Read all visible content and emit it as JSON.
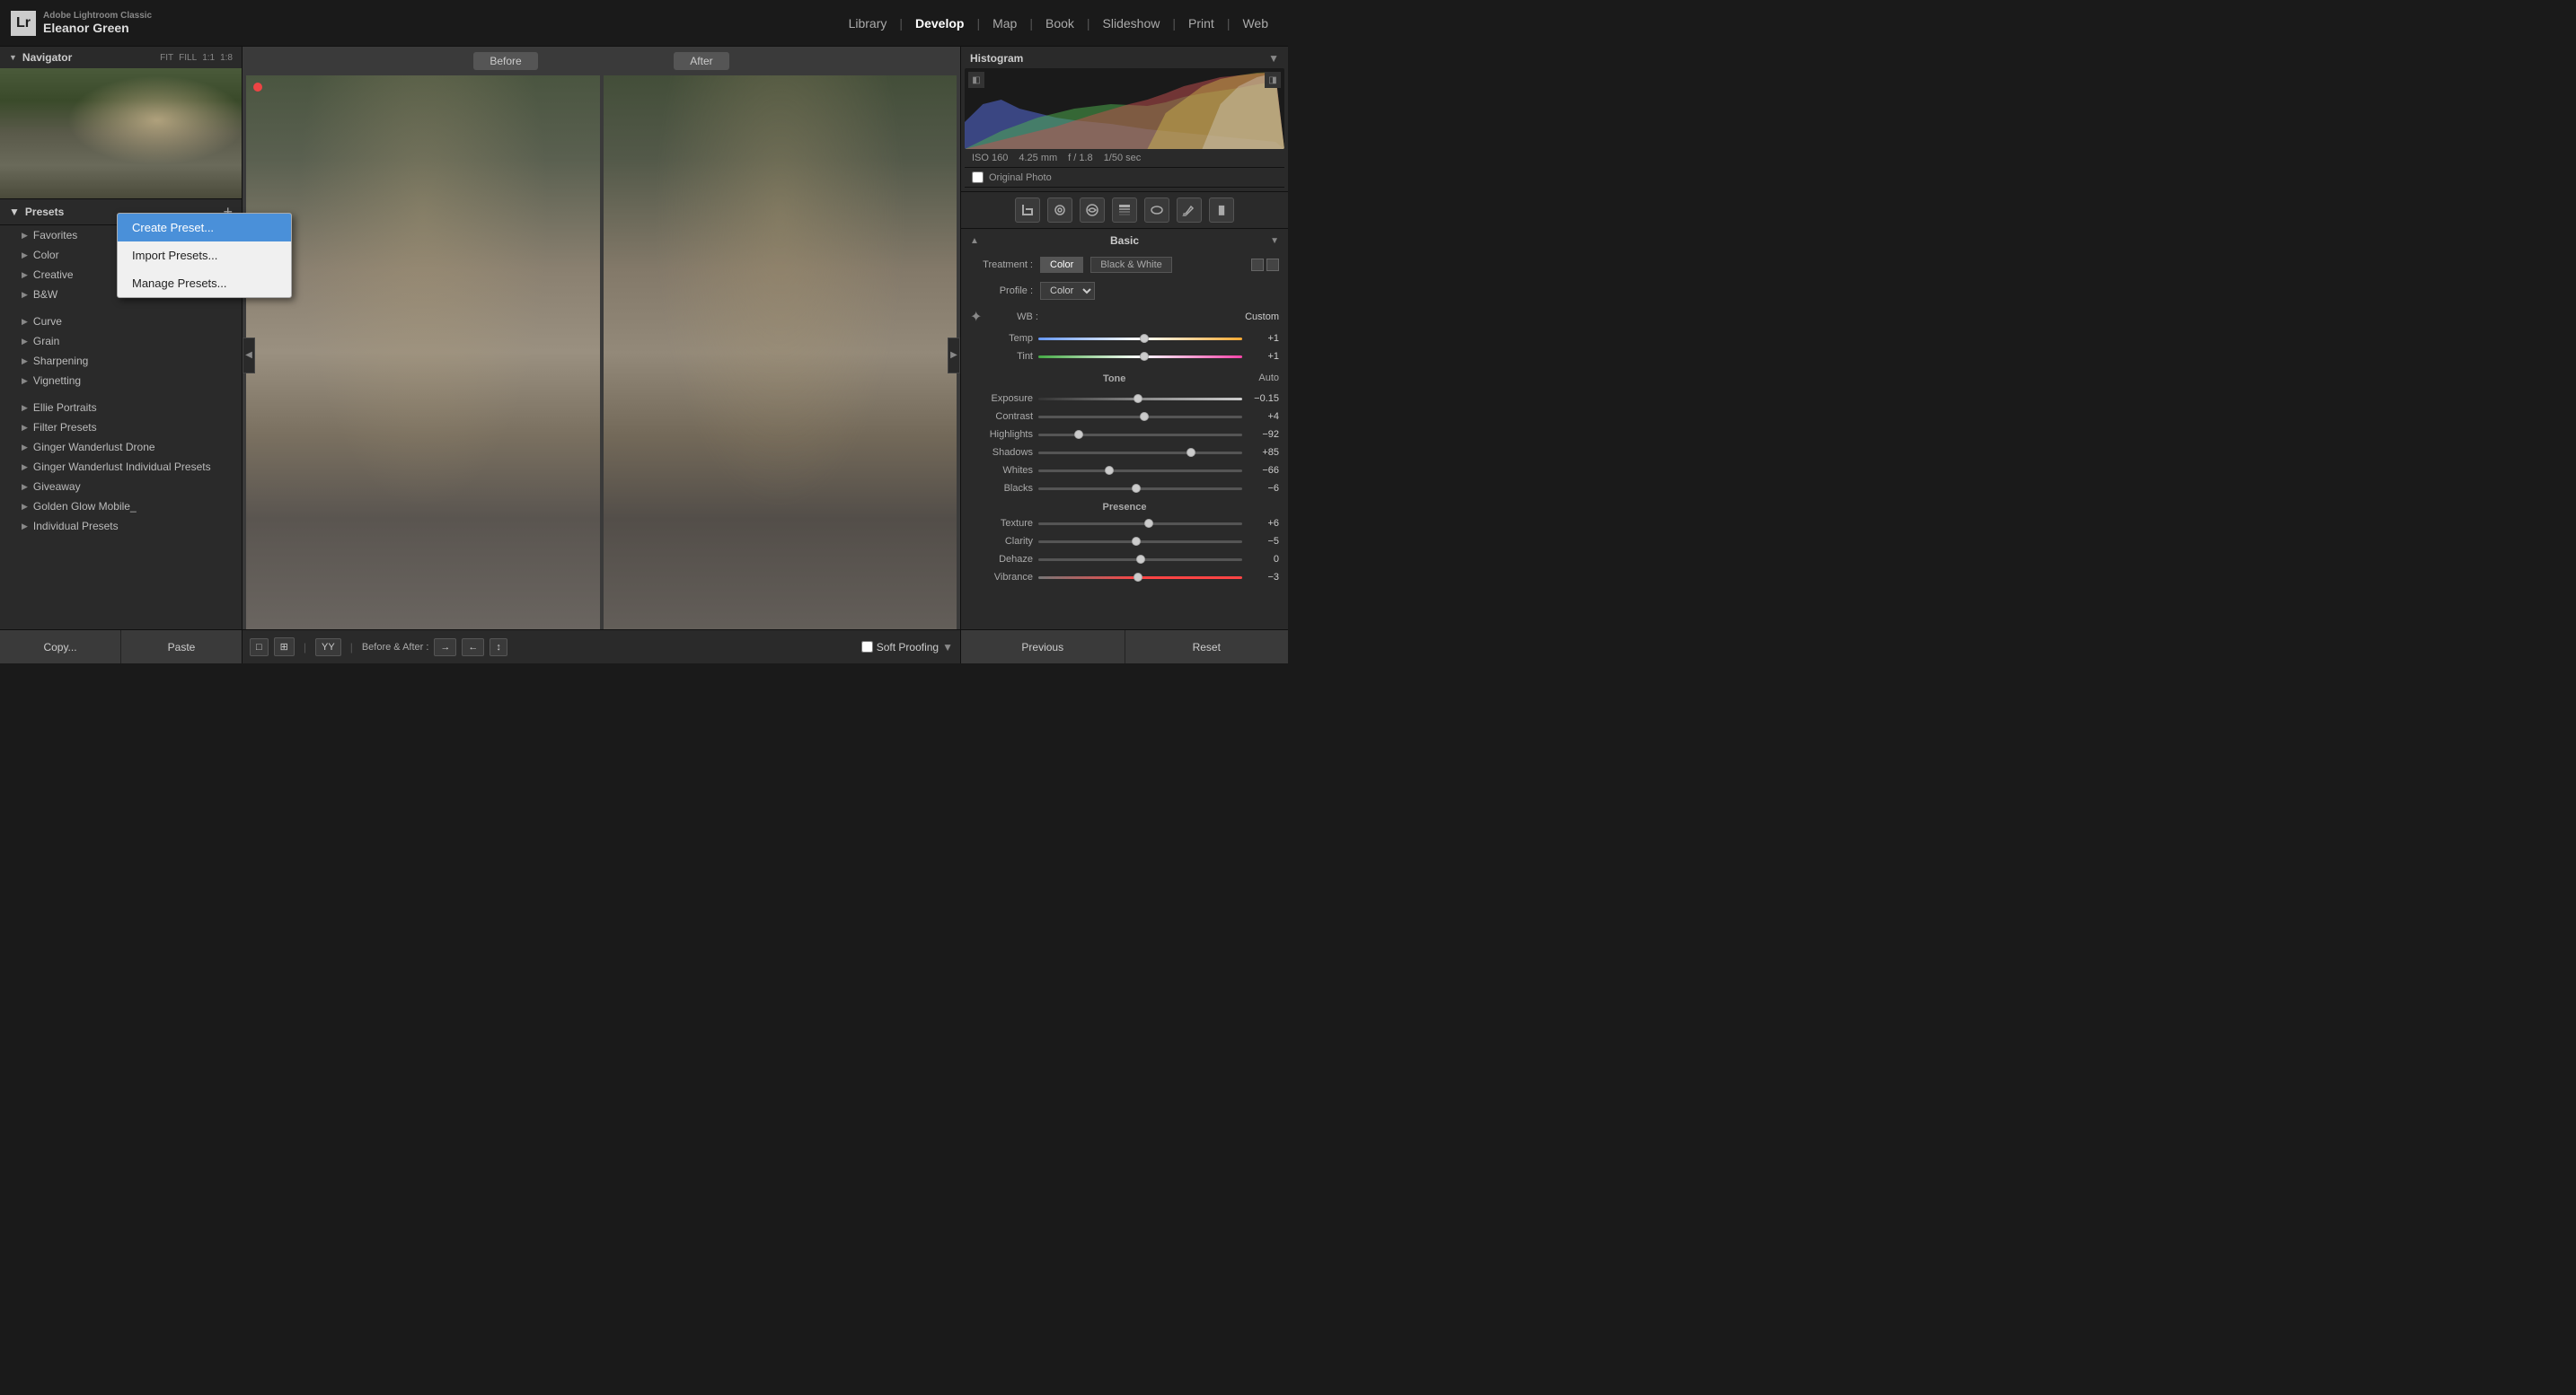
{
  "app": {
    "logo": "Lr",
    "app_name": "Adobe Lightroom Classic",
    "user_name": "Eleanor Green"
  },
  "nav": {
    "items": [
      "Library",
      "Develop",
      "Map",
      "Book",
      "Slideshow",
      "Print",
      "Web"
    ],
    "active": "Develop",
    "separators": [
      true,
      false,
      true,
      true,
      false,
      true,
      true
    ]
  },
  "navigator": {
    "title": "Navigator",
    "zoom_options": [
      "FIT",
      "FILL",
      "1:1",
      "1:8"
    ]
  },
  "presets": {
    "title": "Presets",
    "add_btn": "+",
    "items": [
      {
        "label": "Favorites",
        "level": 1
      },
      {
        "label": "Color",
        "level": 1
      },
      {
        "label": "Creative",
        "level": 1
      },
      {
        "label": "B&W",
        "level": 1
      },
      {
        "label": "Curve",
        "level": 1
      },
      {
        "label": "Grain",
        "level": 1
      },
      {
        "label": "Sharpening",
        "level": 1
      },
      {
        "label": "Vignetting",
        "level": 1
      },
      {
        "label": "Ellie Portraits",
        "level": 1
      },
      {
        "label": "Filter Presets",
        "level": 1
      },
      {
        "label": "Ginger Wanderlust Drone",
        "level": 1
      },
      {
        "label": "Ginger Wanderlust Individual Presets",
        "level": 1
      },
      {
        "label": "Giveaway",
        "level": 1
      },
      {
        "label": "Golden Glow Mobile_",
        "level": 1
      },
      {
        "label": "Individual Presets",
        "level": 1
      }
    ]
  },
  "context_menu": {
    "items": [
      "Create Preset...",
      "Import Presets...",
      "Manage Presets..."
    ],
    "selected": 0
  },
  "bottom_bar": {
    "tools": [
      "□",
      "⊞",
      "YY"
    ],
    "before_after_label": "Before & After :",
    "arrows": [
      "→",
      "←",
      "↕"
    ],
    "soft_proofing": "Soft Proofing"
  },
  "before_label": "Before",
  "after_label": "After",
  "histogram": {
    "title": "Histogram",
    "exif": {
      "iso": "ISO 160",
      "focal": "4.25 mm",
      "aperture": "f / 1.8",
      "shutter": "1/50 sec"
    },
    "original_photo": "Original Photo"
  },
  "basic": {
    "title": "Basic",
    "treatment_label": "Treatment :",
    "treatment_color": "Color",
    "treatment_bw": "Black & White",
    "profile_label": "Profile :",
    "profile_value": "Color",
    "wb_label": "WB :",
    "wb_value": "Custom",
    "controls": [
      {
        "label": "Temp",
        "value": "+1",
        "pos": 52,
        "track": "temp"
      },
      {
        "label": "Tint",
        "value": "+1",
        "pos": 52,
        "track": "tint"
      },
      {
        "label": "Tone",
        "value": "Auto",
        "is_title": true
      },
      {
        "label": "Exposure",
        "value": "−0.15",
        "pos": 49,
        "track": "exposure"
      },
      {
        "label": "Contrast",
        "value": "+4",
        "pos": 52,
        "track": "default"
      },
      {
        "label": "Highlights",
        "value": "−92",
        "pos": 20,
        "track": "default"
      },
      {
        "label": "Shadows",
        "value": "+85",
        "pos": 75,
        "track": "default"
      },
      {
        "label": "Whites",
        "value": "−66",
        "pos": 35,
        "track": "default"
      },
      {
        "label": "Blacks",
        "value": "−6",
        "pos": 48,
        "track": "default"
      },
      {
        "label": "Presence",
        "value": "",
        "is_title": true
      },
      {
        "label": "Texture",
        "value": "+6",
        "pos": 54,
        "track": "default"
      },
      {
        "label": "Clarity",
        "value": "−5",
        "pos": 48,
        "track": "default"
      },
      {
        "label": "Dehaze",
        "value": "0",
        "pos": 50,
        "track": "default"
      },
      {
        "label": "Vibrance",
        "value": "−3",
        "pos": 49,
        "track": "vibrance"
      }
    ]
  },
  "right_bottom": {
    "previous": "Previous",
    "reset": "Reset"
  },
  "left_bottom": {
    "copy": "Copy...",
    "paste": "Paste"
  }
}
